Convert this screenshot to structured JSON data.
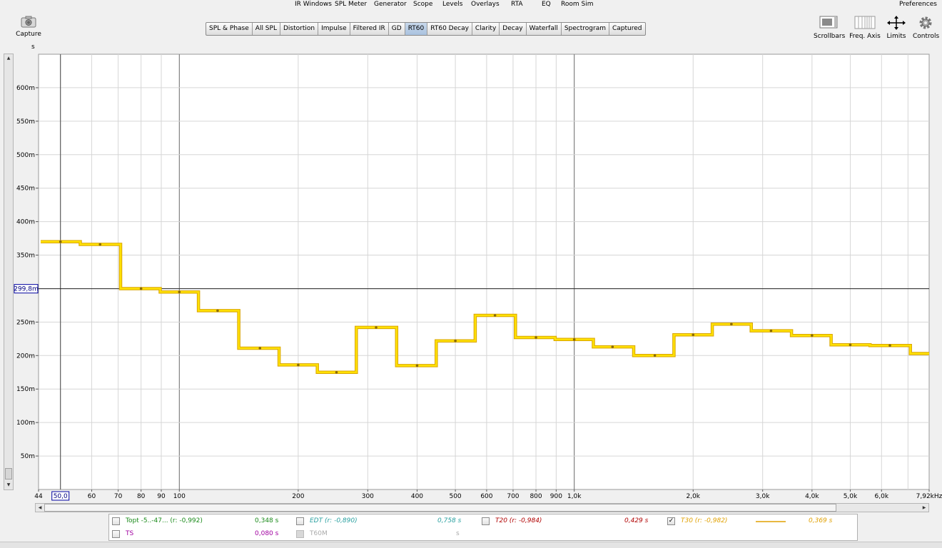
{
  "menu": {
    "items": [
      "IR Windows",
      "SPL Meter",
      "Generator",
      "Scope",
      "Levels",
      "Overlays",
      "RTA",
      "EQ",
      "Room Sim"
    ],
    "preferences": "Preferences"
  },
  "capture": {
    "label": "Capture",
    "icon": "camera-icon"
  },
  "tabs": [
    {
      "label": "SPL & Phase",
      "active": false
    },
    {
      "label": "All SPL",
      "active": false
    },
    {
      "label": "Distortion",
      "active": false
    },
    {
      "label": "Impulse",
      "active": false
    },
    {
      "label": "Filtered IR",
      "active": false
    },
    {
      "label": "GD",
      "active": false
    },
    {
      "label": "RT60",
      "active": true
    },
    {
      "label": "RT60 Decay",
      "active": false
    },
    {
      "label": "Clarity",
      "active": false
    },
    {
      "label": "Decay",
      "active": false
    },
    {
      "label": "Waterfall",
      "active": false
    },
    {
      "label": "Spectrogram",
      "active": false
    },
    {
      "label": "Captured",
      "active": false
    }
  ],
  "toolbar": {
    "scrollbars": "Scrollbars",
    "freq_axis": "Freq. Axis",
    "limits": "Limits",
    "controls": "Controls"
  },
  "chart_data": {
    "type": "line",
    "step": true,
    "ylabel": "s",
    "xscale": "log",
    "xlim": [
      44,
      7920
    ],
    "ylim": [
      0,
      0.65
    ],
    "x_ticks": [
      {
        "v": 44,
        "label": "44"
      },
      {
        "v": 60,
        "label": "60"
      },
      {
        "v": 70,
        "label": "70"
      },
      {
        "v": 80,
        "label": "80"
      },
      {
        "v": 90,
        "label": "90"
      },
      {
        "v": 100,
        "label": "100"
      },
      {
        "v": 200,
        "label": "200"
      },
      {
        "v": 300,
        "label": "300"
      },
      {
        "v": 400,
        "label": "400"
      },
      {
        "v": 500,
        "label": "500"
      },
      {
        "v": 600,
        "label": "600"
      },
      {
        "v": 700,
        "label": "700"
      },
      {
        "v": 800,
        "label": "800"
      },
      {
        "v": 900,
        "label": "900"
      },
      {
        "v": 1000,
        "label": "1,0k"
      },
      {
        "v": 2000,
        "label": "2,0k"
      },
      {
        "v": 3000,
        "label": "3,0k"
      },
      {
        "v": 4000,
        "label": "4,0k"
      },
      {
        "v": 5000,
        "label": "5,0k"
      },
      {
        "v": 6000,
        "label": "6,0k"
      },
      {
        "v": 7920,
        "label": "7,92kHz"
      }
    ],
    "y_ticks": [
      {
        "v": 0.05,
        "label": "50m"
      },
      {
        "v": 0.1,
        "label": "100m"
      },
      {
        "v": 0.15,
        "label": "150m"
      },
      {
        "v": 0.2,
        "label": "200m"
      },
      {
        "v": 0.25,
        "label": "250m"
      },
      {
        "v": 0.3,
        "label": "300m"
      },
      {
        "v": 0.35,
        "label": "350m"
      },
      {
        "v": 0.4,
        "label": "400m"
      },
      {
        "v": 0.45,
        "label": "450m"
      },
      {
        "v": 0.5,
        "label": "500m"
      },
      {
        "v": 0.55,
        "label": "550m"
      },
      {
        "v": 0.6,
        "label": "600m"
      }
    ],
    "cursor": {
      "x": 50,
      "y": 0.2998,
      "x_label": "50,0",
      "y_label": "299,8m"
    },
    "series": [
      {
        "name": "T30",
        "color": "#ffe100",
        "edge_color": "#d9a400",
        "x": [
          50,
          63,
          80,
          100,
          125,
          160,
          200,
          250,
          315,
          400,
          500,
          630,
          800,
          1000,
          1250,
          1600,
          2000,
          2500,
          3150,
          4000,
          5000,
          6300,
          8000
        ],
        "y": [
          0.37,
          0.366,
          0.3,
          0.295,
          0.267,
          0.211,
          0.186,
          0.175,
          0.242,
          0.185,
          0.222,
          0.26,
          0.227,
          0.224,
          0.213,
          0.2,
          0.231,
          0.247,
          0.237,
          0.23,
          0.216,
          0.215,
          0.203
        ]
      }
    ]
  },
  "legend": [
    {
      "name": "Topt -5..-47... (r: -0,992)",
      "value": "0,348 s",
      "color": "#1a8a1a",
      "checked": false,
      "italic": false
    },
    {
      "name": "EDT (r: -0,890)",
      "value": "0,758 s",
      "color": "#2aa0a0",
      "checked": false,
      "italic": true
    },
    {
      "name": "T20 (r: -0,984)",
      "value": "0,429 s",
      "color": "#b00000",
      "checked": false,
      "italic": true
    },
    {
      "name": "T30 (r: -0,982)",
      "value": "0,369 s",
      "color": "#e0a000",
      "checked": true,
      "italic": true
    },
    {
      "name": "TS",
      "value": "0,080 s",
      "color": "#a000a0",
      "checked": false,
      "italic": false
    },
    {
      "name": "T60M",
      "value": "s",
      "color": "#aaaaaa",
      "checked": false,
      "italic": false
    }
  ]
}
